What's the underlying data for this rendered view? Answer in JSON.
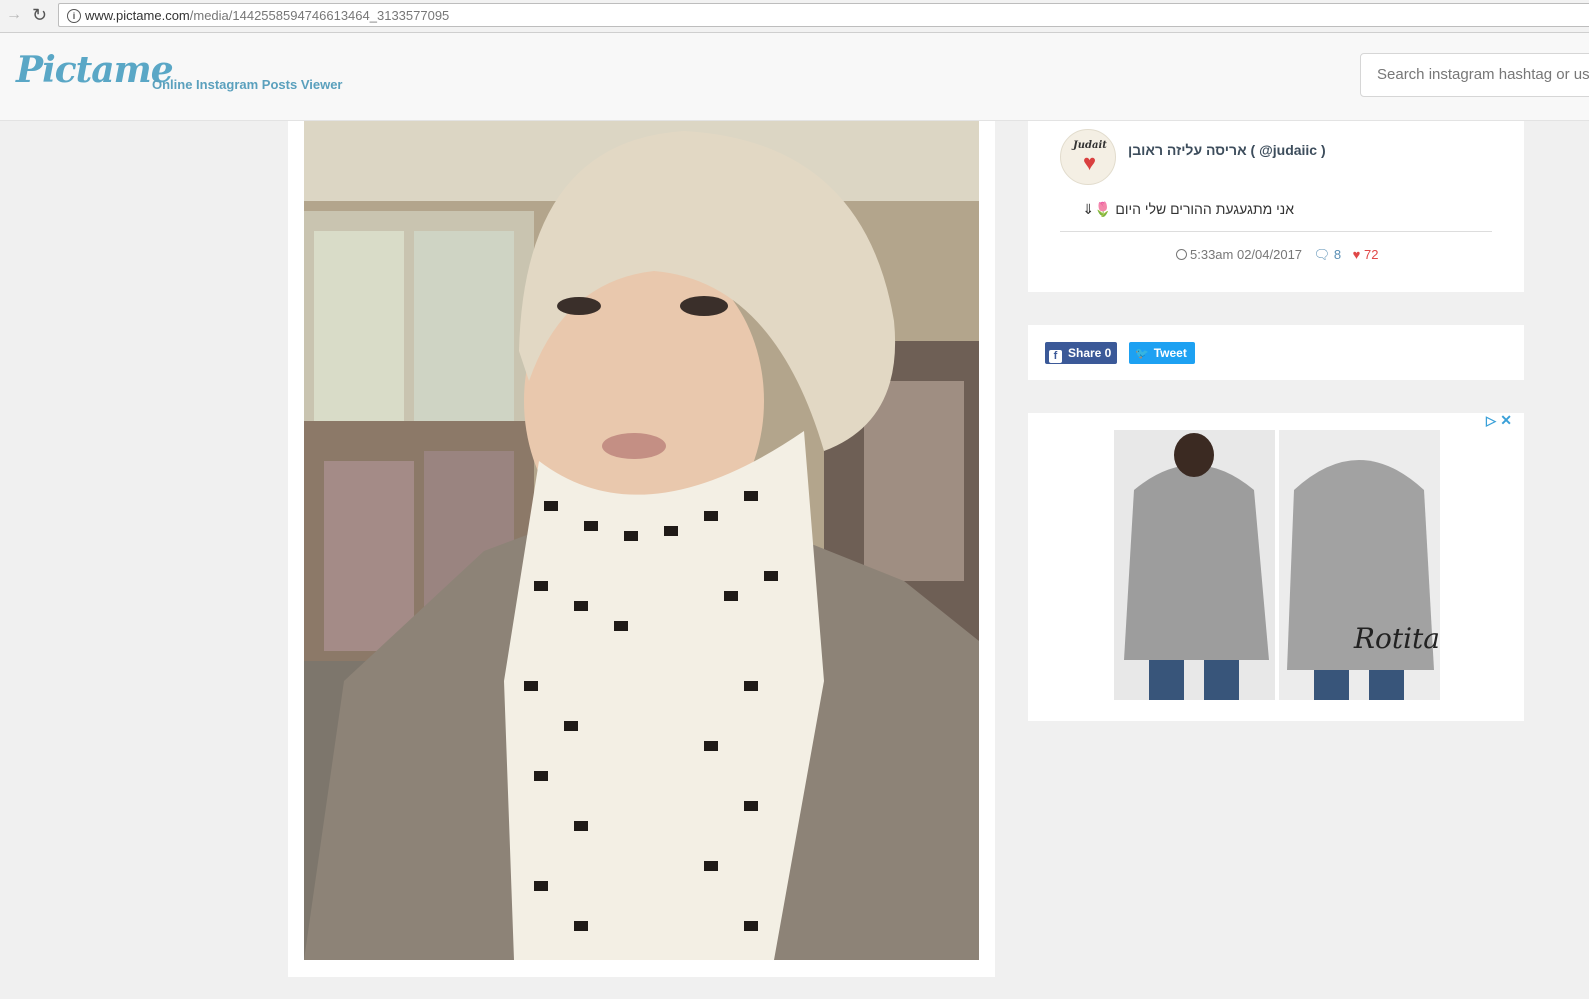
{
  "browser": {
    "url_host": "www.pictame.com",
    "url_path": "/media/1442558594746613464_3133577095"
  },
  "header": {
    "logo": "Pictame",
    "tagline": "Online Instagram Posts Viewer",
    "search_placeholder": "Search instagram hashtag or user"
  },
  "post": {
    "username": "אריסה עליזה ראובן ( @judaiic )",
    "caption": "אני מתגעגעת ההורים שלי היום 🌷⇓",
    "time": "5:33am 02/04/2017",
    "comments": "8",
    "likes": "72",
    "avatar_text": "Judait"
  },
  "share": {
    "share_label": "Share 0",
    "tweet_label": "Tweet"
  },
  "ad": {
    "brand": "Rotita"
  }
}
